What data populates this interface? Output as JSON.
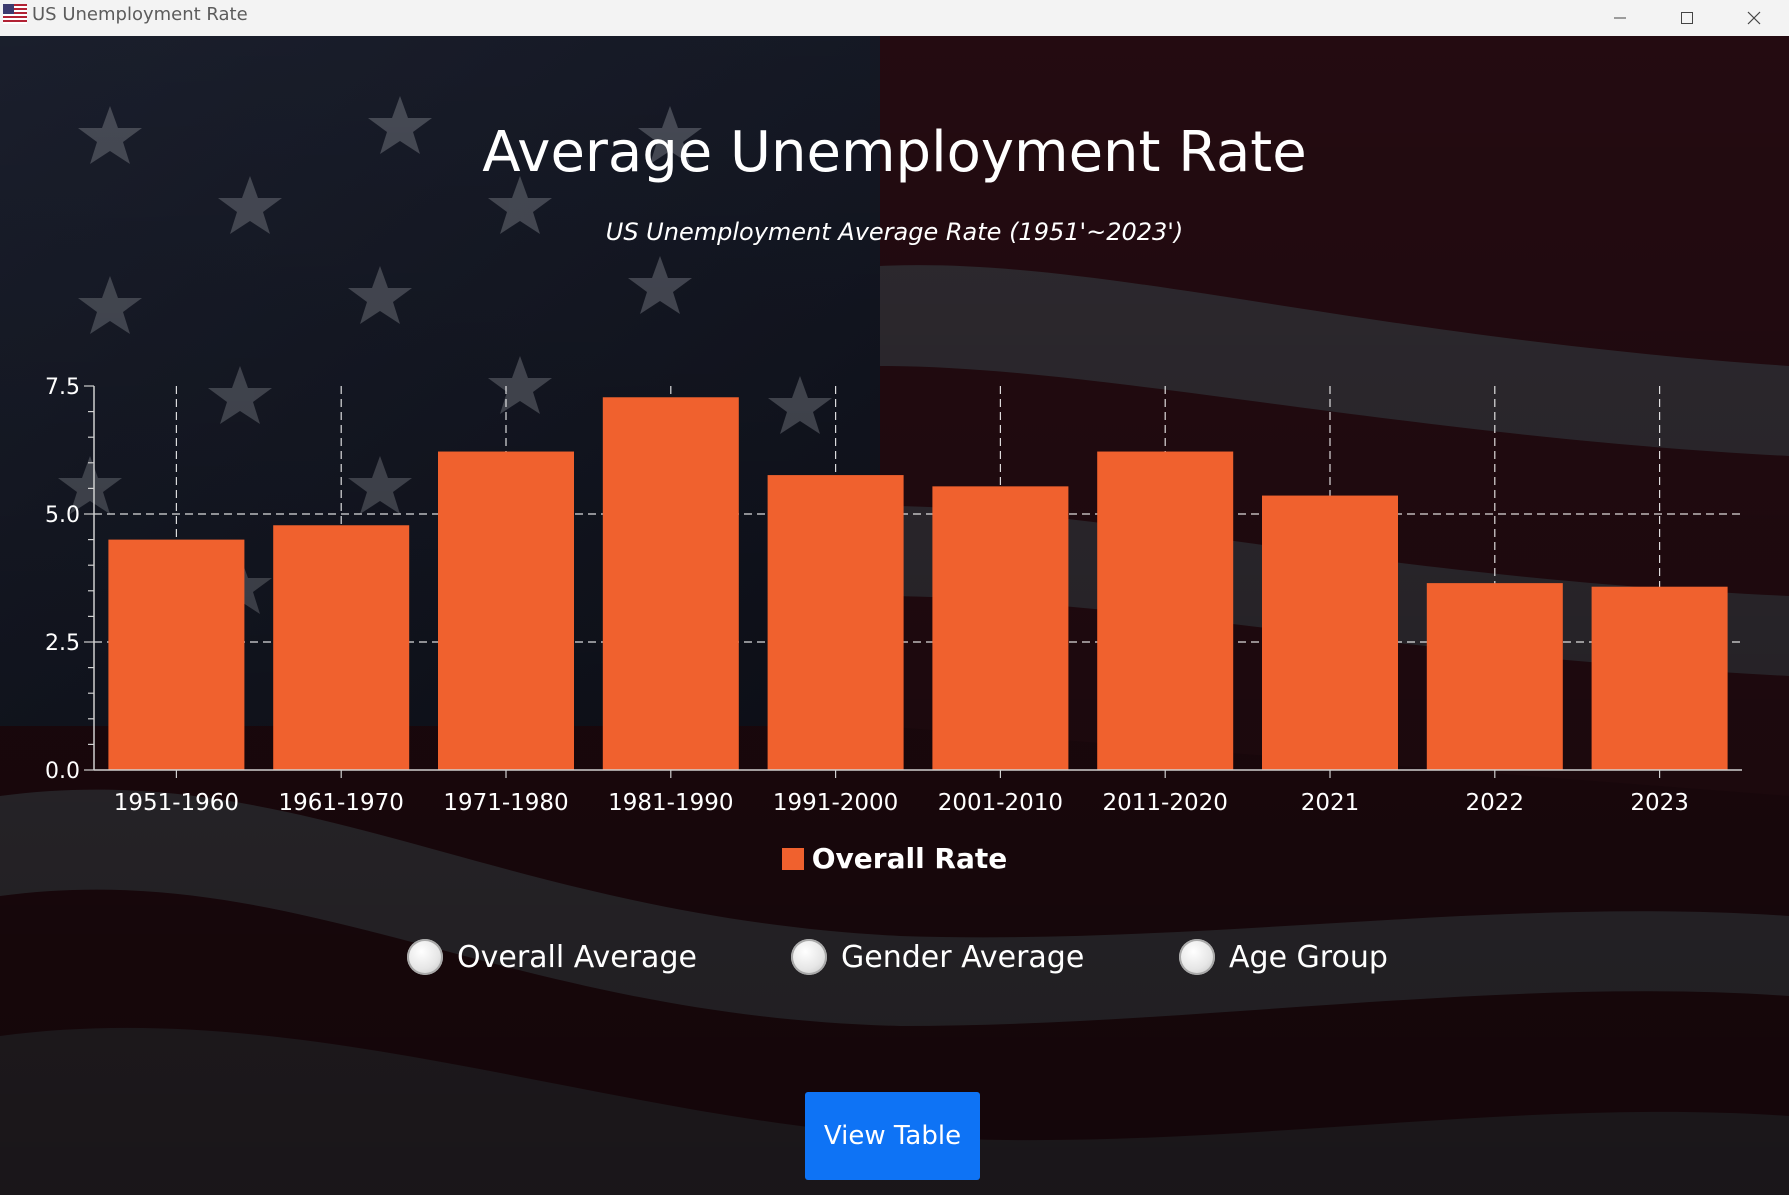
{
  "window": {
    "title": "US Unemployment Rate",
    "icon": "us-flag-icon"
  },
  "colors": {
    "bar": "#f0612e",
    "button": "#0e73f5",
    "text": "#ffffff"
  },
  "chart_data": {
    "type": "bar",
    "title": "Average Unemployment Rate",
    "subtitle": "US Unemployment Average Rate (1951'~2023')",
    "categories": [
      "1951-1960",
      "1961-1970",
      "1971-1980",
      "1981-1990",
      "1991-2000",
      "2001-2010",
      "2011-2020",
      "2021",
      "2022",
      "2023"
    ],
    "series": [
      {
        "name": "Overall Rate",
        "values": [
          4.5,
          4.78,
          6.22,
          7.28,
          5.76,
          5.54,
          6.22,
          5.36,
          3.65,
          3.58
        ]
      }
    ],
    "ylim": [
      0,
      7.5
    ],
    "yticks": [
      "0.0",
      "2.5",
      "5.0",
      "7.5"
    ],
    "grid": true,
    "legend_position": "bottom"
  },
  "controls": {
    "radios": [
      {
        "label": "Overall Average"
      },
      {
        "label": "Gender Average"
      },
      {
        "label": "Age Group"
      }
    ],
    "view_button": "View Table"
  }
}
